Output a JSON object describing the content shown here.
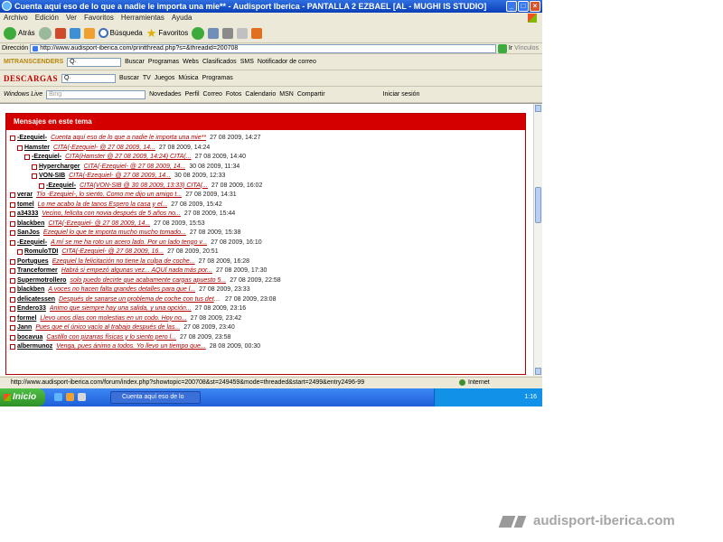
{
  "window": {
    "title": "Cuenta aquí eso de lo que a nadie le importa una mie** - Audisport Iberica - PANTALLA 2 EZBAEL [AL - MUGHI IS STUDIO]"
  },
  "menu": [
    "Archivo",
    "Edición",
    "Ver",
    "Favoritos",
    "Herramientas",
    "Ayuda"
  ],
  "toolbar": {
    "back": "Atrás",
    "search": "Búsqueda",
    "favorites": "Favoritos"
  },
  "address": {
    "label": "Dirección",
    "url": "http://www.audisport-iberica.com/printthread.php?s=&threadid=200708",
    "go": "Ir",
    "links": "Vínculos"
  },
  "linkbar1": {
    "brand": "MITRANSCENDERS",
    "buscar": "Buscar",
    "programas": "Programas",
    "webs": "Webs",
    "clasificados": "Clasificados",
    "sms": "SMS",
    "notificador": "Notificador de correo"
  },
  "linkbar2": {
    "brand": "DESCARGAS",
    "buscar": "Buscar",
    "tv": "TV",
    "juegos": "Juegos",
    "musica": "Música",
    "programas": "Programas"
  },
  "linkbar3": {
    "brand": "Windows Live",
    "search_placeholder": "Bing",
    "novedades": "Novedades",
    "perfil": "Perfil",
    "correo": "Correo",
    "fotos": "Fotos",
    "calendario": "Calendario",
    "msn": "MSN",
    "compartir": "Compartir",
    "iniciar_sesion": "Iniciar sesión"
  },
  "panel": {
    "header": "Mensajes en este tema"
  },
  "posts": [
    {
      "indent": 0,
      "user": "-Ezequiel-",
      "subject": "Cuenta aquí eso de lo que a nadie le importa una mie**",
      "date": "27 08 2009, 14:27"
    },
    {
      "indent": 1,
      "user": "Hamster",
      "subject": "CITA(-Ezequiel- @ 27 08 2009, 14...",
      "date": "27 08 2009, 14:24"
    },
    {
      "indent": 2,
      "user": "-Ezequiel-",
      "subject": "CITA(Hamster @ 27 08 2009, 14:24) CITA(...",
      "date": "27 08 2009, 14:40"
    },
    {
      "indent": 3,
      "user": "Hypercharger",
      "subject": "CITA(-Ezequiel- @ 27 08 2009, 14...",
      "date": "30 08 2009, 11:34"
    },
    {
      "indent": 3,
      "user": "VON-SIB",
      "subject": "CITA(-Ezequiel- @ 27 08 2009, 14...",
      "date": "30 08 2009, 12:33"
    },
    {
      "indent": 4,
      "user": "-Ezequiel-",
      "subject": "CITA(VON-SIB @ 30 08 2009, 13:33) CITA(...",
      "date": "27 08 2009, 16:02"
    },
    {
      "indent": 0,
      "user": "verar",
      "subject": "Tío -Ezequiel-, lo siento. Como me dijo un amigo t...",
      "date": "27 08 2009, 14:31"
    },
    {
      "indent": 0,
      "user": "tomel",
      "subject": "Lo me acabo la de tanos Espero la casa y el...",
      "date": "27 08 2009, 15:42"
    },
    {
      "indent": 0,
      "user": "a34333",
      "subject": "Vecino, felicita con novia después de 5 años no...",
      "date": "27 08 2009, 15:44"
    },
    {
      "indent": 0,
      "user": "blackben",
      "subject": "CITA(-Ezequiel- @ 27 08 2009, 14...",
      "date": "27 08 2009, 15:53"
    },
    {
      "indent": 0,
      "user": "SanJos",
      "subject": "Ezequiel lo que te importa mucho mucho tomado...",
      "date": "27 08 2009, 15:38"
    },
    {
      "indent": 0,
      "user": "-Ezequiel-",
      "subject": "A mí se me ha roto un acero lado. Por un lado tengo v...",
      "date": "27 08 2009, 16:10"
    },
    {
      "indent": 1,
      "user": "RomuloTDI",
      "subject": "CITA(-Ezequiel- @ 27 08 2009, 16...",
      "date": "27 08 2009, 20:51"
    },
    {
      "indent": 0,
      "user": "Portugues",
      "subject": "Ezequiel la felicitación no tiene la culpa de coche...",
      "date": "27 08 2009, 16:28"
    },
    {
      "indent": 0,
      "user": "Tranceformer",
      "subject": "Habrá si empezó algunas vez... AQUÍ nada más por...",
      "date": "27 08 2009, 17:30"
    },
    {
      "indent": 0,
      "user": "Supermotrollero",
      "subject": "solo puedo decirte que acabamente cargas apuesto 5...",
      "date": "27 08 2009, 22:58"
    },
    {
      "indent": 0,
      "user": "blackben",
      "subject": "A voces no hacen falta grandes detalles para que l...",
      "date": "27 08 2009, 23:33"
    },
    {
      "indent": 0,
      "user": "delicatessen",
      "subject": "Después de sanarse un problema de coche con tus detalles...",
      "date": "27 08 2009, 23:08"
    },
    {
      "indent": 0,
      "user": "Endero33",
      "subject": "Animo que siempre hay una salida, y una opción...",
      "date": "27 08 2009, 23:16"
    },
    {
      "indent": 0,
      "user": "formel",
      "subject": "Llevo unos días con molestias en un codo. Hoy no...",
      "date": "27 08 2009, 23:42"
    },
    {
      "indent": 0,
      "user": "Jann",
      "subject": "Pues que el único vacío al trabajo después de las...",
      "date": "27 08 2009, 23:40"
    },
    {
      "indent": 0,
      "user": "bocavua",
      "subject": "Castillo con pizarras físicas y lo siento pero l...",
      "date": "27 08 2009, 23:58"
    },
    {
      "indent": 0,
      "user": "albermunoz",
      "subject": "Venga, pues ánimo a todos. Yo llevo un tiempo que...",
      "date": "28 08 2009, 00:30"
    }
  ],
  "status": {
    "url": "http://www.audisport-iberica.com/forum/index.php?showtopic=200708&st=249459&mode=threaded&start=2499&entry2496-99",
    "zone": "Internet"
  },
  "taskbar": {
    "start": "Inicio",
    "task": "Cuenta aquí eso de lo",
    "clock": "1:16"
  },
  "watermark": {
    "text": "audisport-iberica.com"
  }
}
